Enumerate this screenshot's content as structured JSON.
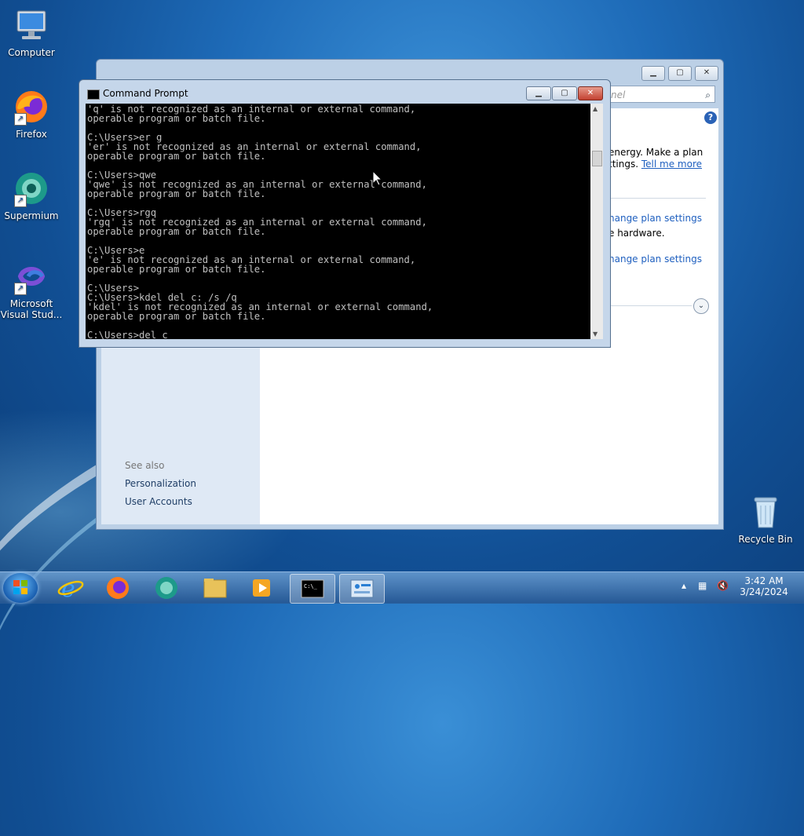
{
  "desktop": {
    "icons": [
      {
        "label": "Computer",
        "icon": "computer-icon"
      },
      {
        "label": "Firefox",
        "icon": "firefox-icon"
      },
      {
        "label": "Supermium",
        "icon": "supermium-icon"
      },
      {
        "label": "Microsoft Visual Stud...",
        "icon": "visual-studio-icon"
      },
      {
        "label": "Recycle Bin",
        "icon": "recycle-bin-icon"
      }
    ]
  },
  "control_panel": {
    "search_placeholder": "nel",
    "text_energy": "energy. Make a plan",
    "text_settings": "ttings.",
    "link_tell_me_more": "Tell me more",
    "link_change_plan_1": "hange plan settings",
    "text_hardware": "e hardware.",
    "link_change_plan_2": "hange plan settings",
    "see_also": "See also",
    "link_personalization": "Personalization",
    "link_user_accounts": "User Accounts"
  },
  "cmd": {
    "title": "Command Prompt",
    "console_text": "'q' is not recognized as an internal or external command,\noperable program or batch file.\n\nC:\\Users>er g\n'er' is not recognized as an internal or external command,\noperable program or batch file.\n\nC:\\Users>qwe\n'qwe' is not recognized as an internal or external command,\noperable program or batch file.\n\nC:\\Users>rgq\n'rgq' is not recognized as an internal or external command,\noperable program or batch file.\n\nC:\\Users>e\n'e' is not recognized as an internal or external command,\noperable program or batch file.\n\nC:\\Users>\nC:\\Users>kdel del c: /s /q\n'kdel' is not recognized as an internal or external command,\noperable program or batch file.\n\nC:\\Users>del c"
  },
  "taskbar": {
    "items": [
      "start",
      "internet-explorer",
      "firefox",
      "supermium",
      "file-explorer",
      "media-player",
      "command-prompt",
      "control-panel"
    ],
    "clock_time": "3:42 AM",
    "clock_date": "3/24/2024"
  }
}
